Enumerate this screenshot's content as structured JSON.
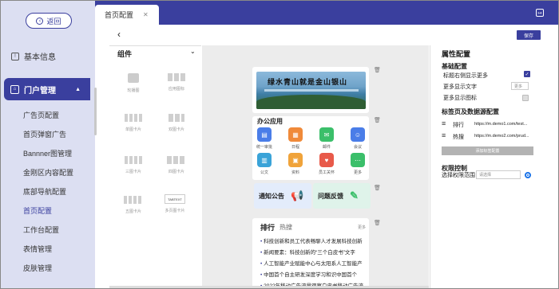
{
  "sidebar": {
    "back_label": "返回",
    "basic_info": "基本信息",
    "portal": "门户管理",
    "items": [
      "广告页配置",
      "首页弹窗广告",
      "Bannner图管理",
      "金刚区内容配置",
      "底部导航配置",
      "首页配置",
      "工作台配置",
      "表情管理",
      "皮肤管理"
    ]
  },
  "tab": {
    "label": "首页配置"
  },
  "toolbar": {
    "save_label": "保存"
  },
  "components": {
    "title": "组件",
    "items": [
      "轮播图",
      "应用图标",
      "单图卡片",
      "双图卡片",
      "三图卡片",
      "四图卡片",
      "五图卡片",
      "多页图卡片"
    ],
    "more_tag": "TABTEXT"
  },
  "canvas": {
    "banner_text": "绿水青山就是金山银山",
    "office_title": "办公应用",
    "apps": [
      "统一审批",
      "日程",
      "邮件",
      "会议",
      "公文",
      "资料",
      "员工关怀",
      "更多"
    ],
    "notice": "通知公告",
    "feedback": "问题反馈",
    "news_tabs": [
      "排行",
      "热搜"
    ],
    "news_more": "更多",
    "news": [
      "科技创新和员工代表畅聊人才发展科技创新",
      "新闻要素：科技创新的“三个白皮书”文字",
      "人工智能产业赋能中心与太阳系人工智能产",
      "中国首个自主研发深度学习和识中国首个",
      "2022年移动广告流量观察白皮书移动广告流"
    ]
  },
  "props": {
    "title": "属性配置",
    "basic": "基础配置",
    "show_more_right": "标题右侧显示更多",
    "more_text": "更多显示文字",
    "more_text_value": "更多",
    "more_icon": "更多显示图标",
    "tab_source": "标签页及数据源配置",
    "tab1_name": "排行",
    "tab1_url": "https://m.demo1.com/test...",
    "tab2_name": "热搜",
    "tab2_url": "https://m.demo2.com/prud...",
    "add_label": "添加标签配置",
    "perm": "权限控制",
    "scope": "选择权限范围",
    "scope_placeholder": "请选择"
  },
  "colors": {
    "accent": "#3a3f9e",
    "sidebar_bg": "#dcdff2"
  }
}
